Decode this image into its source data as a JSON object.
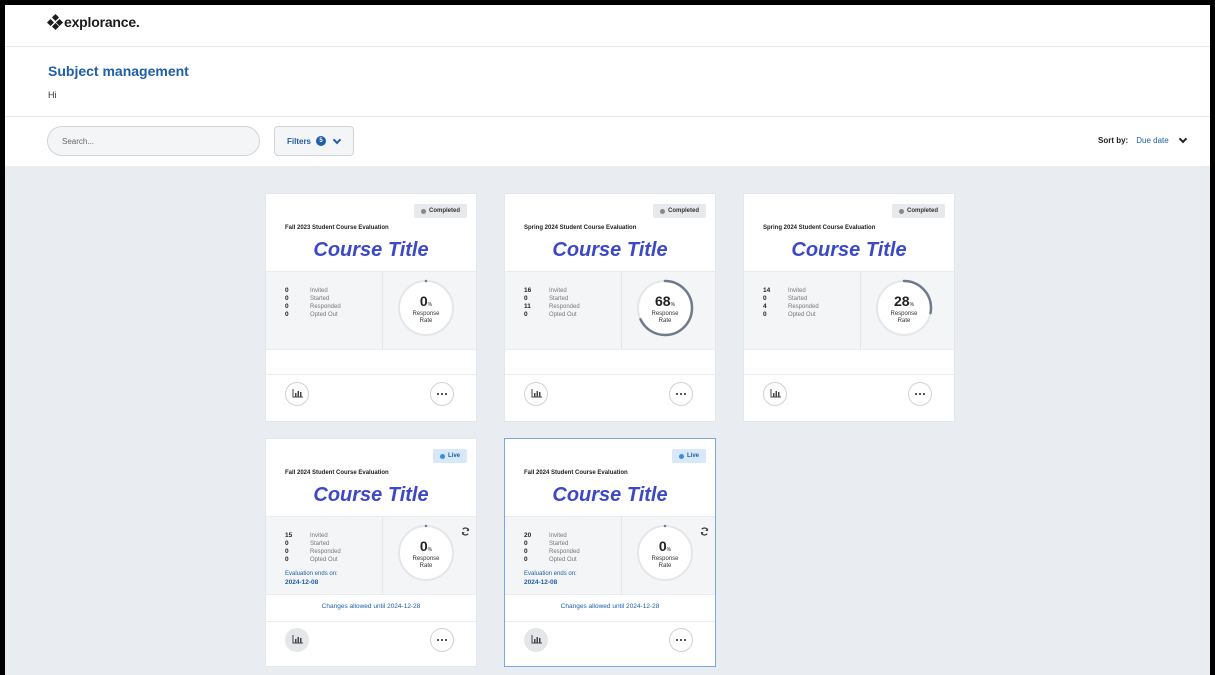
{
  "app": {
    "logo": "explorance."
  },
  "header": {
    "title": "Subject management",
    "greeting": "Hi"
  },
  "toolbar": {
    "search_placeholder": "Search...",
    "filters_label": "Filters",
    "filters_count": "5",
    "sort_label": "Sort by:",
    "sort_value": "Due date"
  },
  "labels": {
    "invited": "Invited",
    "started": "Started",
    "responded": "Responded",
    "opted_out": "Opted Out",
    "response": "Response",
    "rate": "Rate",
    "percent": "%",
    "ends_on": "Evaluation ends on:"
  },
  "cards": [
    {
      "status": "Completed",
      "evaluation": "Fall 2023 Student Course Evaluation",
      "course_title": "Course Title",
      "invited": "0",
      "started": "0",
      "responded": "0",
      "opted_out": "0",
      "rate": "0",
      "rate_fraction": 0
    },
    {
      "status": "Completed",
      "evaluation": "Spring 2024 Student Course Evaluation",
      "course_title": "Course Title",
      "invited": "16",
      "started": "0",
      "responded": "11",
      "opted_out": "0",
      "rate": "68",
      "rate_fraction": 0.68
    },
    {
      "status": "Completed",
      "evaluation": "Spring 2024 Student Course Evaluation",
      "course_title": "Course Title",
      "invited": "14",
      "started": "0",
      "responded": "4",
      "opted_out": "0",
      "rate": "28",
      "rate_fraction": 0.28
    },
    {
      "status": "Live",
      "evaluation": "Fall 2024 Student Course Evaluation",
      "course_title": "Course Title",
      "invited": "15",
      "started": "0",
      "responded": "0",
      "opted_out": "0",
      "rate": "0",
      "rate_fraction": 0,
      "ends_date": "2024-12-08",
      "changes": "Changes allowed until 2024-12-28"
    },
    {
      "status": "Live",
      "evaluation": "Fall 2024 Student Course Evaluation",
      "course_title": "Course Title",
      "invited": "20",
      "started": "0",
      "responded": "0",
      "opted_out": "0",
      "rate": "0",
      "rate_fraction": 0,
      "ends_date": "2024-12-08",
      "changes": "Changes allowed until 2024-12-28"
    }
  ]
}
